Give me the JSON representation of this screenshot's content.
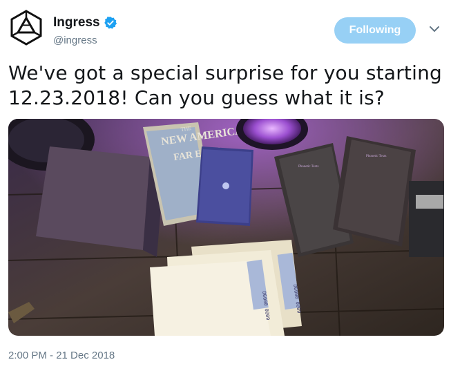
{
  "account": {
    "name": "Ingress",
    "handle": "@ingress",
    "verified": true,
    "avatar_icon": "ingress-logo-icon"
  },
  "follow_button": {
    "label": "Following"
  },
  "menu_icon": "chevron-down-icon",
  "tweet": {
    "text": "We've got a special surprise for you starting 12.23.2018! Can you guess what it is?",
    "timestamp": "2:00 PM - 21 Dec 2018"
  },
  "media": {
    "texts": {
      "magazine_line1": "NEW AMERICA",
      "magazine_line2": "FAR EAST",
      "magazine_small": "THE",
      "folder_label": "D6000 0009"
    }
  },
  "colors": {
    "brand_blue": "#1da1f2",
    "follow_bg": "#97d0f5",
    "text": "#14171a",
    "muted": "#657786"
  }
}
